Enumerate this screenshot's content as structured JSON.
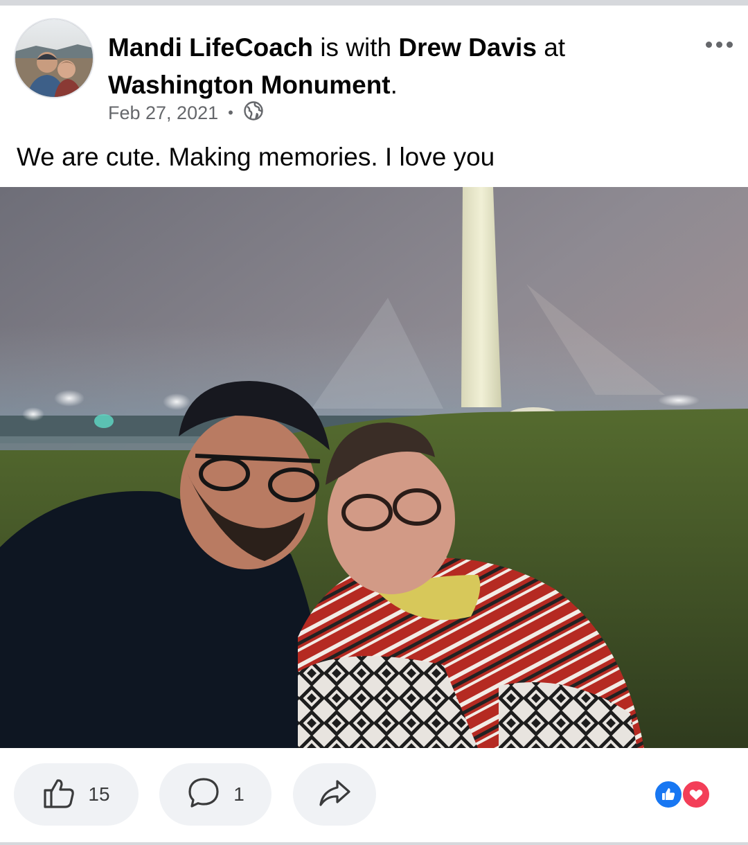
{
  "post": {
    "author": "Mandi LifeCoach",
    "with_word": "is with",
    "tagged_person": "Drew Davis",
    "at_word": "at",
    "location": "Washington Monument",
    "location_end": ".",
    "date": "Feb 27, 2021",
    "separator": "•",
    "audience_icon": "globe-icon",
    "caption": "We are cute. Making memories. I love you"
  },
  "actions": {
    "like_icon": "thumbs-up-icon",
    "like_count": "15",
    "comment_icon": "comment-icon",
    "comment_count": "1",
    "share_icon": "share-icon"
  },
  "reactions": [
    "like-reaction-icon",
    "love-reaction-icon"
  ],
  "colors": {
    "meta_text": "#65676b",
    "pill_bg": "#f0f2f5",
    "like_blue": "#1877f2",
    "love_red": "#f33e58"
  }
}
